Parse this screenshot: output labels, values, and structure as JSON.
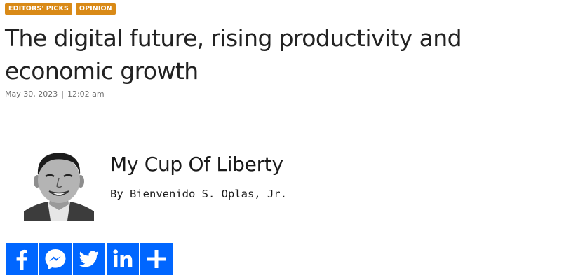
{
  "article": {
    "tags": [
      "EDITORS' PICKS",
      "OPINION"
    ],
    "title": "The digital future, rising productivity and economic growth",
    "date": "May 30, 2023",
    "separator": "|",
    "time": "12:02 am"
  },
  "column": {
    "title": "My Cup Of Liberty",
    "byline": "By Bienvenido S. Oplas, Jr.",
    "photo_icon": "author-portrait"
  },
  "share": {
    "buttons": [
      "facebook-icon",
      "messenger-icon",
      "twitter-icon",
      "linkedin-icon",
      "plus-icon"
    ]
  },
  "colors": {
    "tag_background": "#d98a17",
    "share_background": "#0066ff",
    "title_text": "#222222",
    "meta_text": "#6e6e6e"
  }
}
